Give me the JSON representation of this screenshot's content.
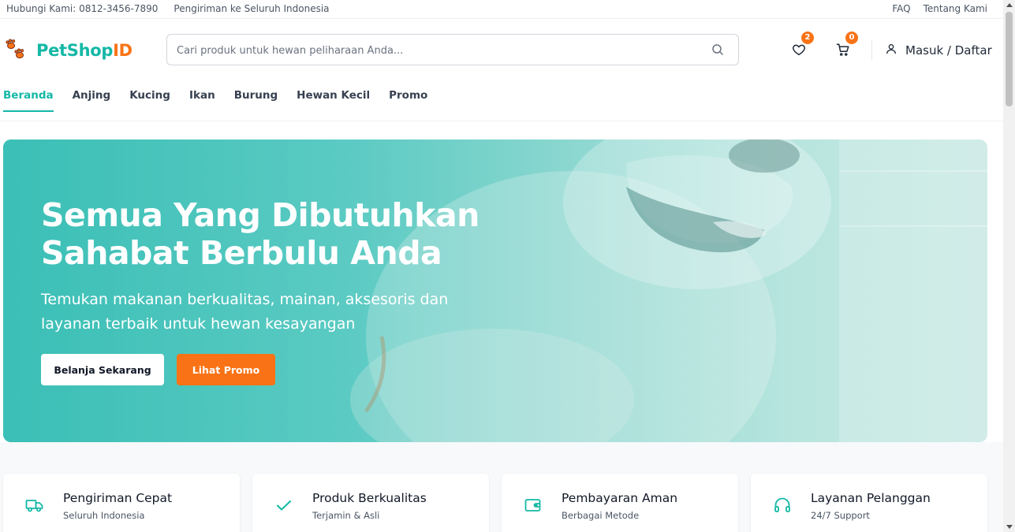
{
  "topbar": {
    "contact": "Hubungi Kami: 0812-3456-7890",
    "shipping": "Pengiriman ke Seluruh Indonesia",
    "links": [
      "FAQ",
      "Tentang Kami"
    ]
  },
  "header": {
    "logo_part1": "PetShop",
    "logo_part2": "ID",
    "search_placeholder": "Cari produk untuk hewan peliharaan Anda...",
    "wishlist_count": "2",
    "cart_count": "0",
    "login_label": "Masuk / Daftar"
  },
  "nav": {
    "items": [
      "Beranda",
      "Anjing",
      "Kucing",
      "Ikan",
      "Burung",
      "Hewan Kecil",
      "Promo"
    ],
    "active": "Beranda"
  },
  "hero": {
    "title_line1": "Semua Yang Dibutuhkan",
    "title_line2": "Sahabat Berbulu Anda",
    "subtitle_line1": "Temukan makanan berkualitas, mainan, aksesoris dan",
    "subtitle_line2": "layanan terbaik untuk hewan kesayangan",
    "primary_button": "Belanja Sekarang",
    "secondary_button": "Lihat Promo"
  },
  "features": [
    {
      "title": "Pengiriman Cepat",
      "subtitle": "Seluruh Indonesia",
      "icon": "truck-icon"
    },
    {
      "title": "Produk Berkualitas",
      "subtitle": "Terjamin & Asli",
      "icon": "check-icon"
    },
    {
      "title": "Pembayaran Aman",
      "subtitle": "Berbagai Metode",
      "icon": "wallet-icon"
    },
    {
      "title": "Layanan Pelanggan",
      "subtitle": "24/7 Support",
      "icon": "headphones-icon"
    }
  ],
  "colors": {
    "brand_teal": "#14b8a6",
    "brand_orange": "#f97316"
  }
}
